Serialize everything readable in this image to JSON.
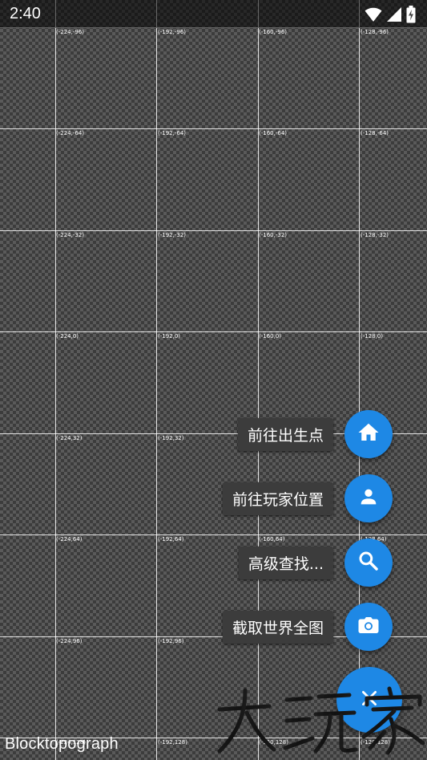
{
  "status_bar": {
    "time": "2:40",
    "icons": [
      "wifi-icon",
      "cell-signal-icon",
      "battery-charging-icon"
    ]
  },
  "map": {
    "coords": [
      "(-224,-96)",
      "(-192,-96)",
      "(-160,-96)",
      "(-128,-96)",
      "(-224,-64)",
      "(-192,-64)",
      "(-160,-64)",
      "(-128,-64)",
      "(-224,-32)",
      "(-192,-32)",
      "(-160,-32)",
      "(-128,-32)",
      "(-224,0)",
      "(-192,0)",
      "(-160,0)",
      "(-128,0)",
      "(-224,32)",
      "(-192,32)",
      "(-224,64)",
      "(-192,64)",
      "(-160,64)",
      "(-128,64)",
      "(-224,96)",
      "(-192,96)",
      "(-224,128)",
      "(-192,128)",
      "(-160,128)",
      "(-128,128)"
    ]
  },
  "fab_menu": {
    "items": [
      {
        "label": "前往出生点",
        "icon": "home-icon"
      },
      {
        "label": "前往玩家位置",
        "icon": "person-icon"
      },
      {
        "label": "高级查找...",
        "icon": "search-icon"
      },
      {
        "label": "截取世界全图",
        "icon": "camera-icon"
      }
    ],
    "main_icon": "close-icon"
  },
  "app_name": "Blocktopograph",
  "watermark_text": "大玩家",
  "colors": {
    "fab": "#1e88e5",
    "label_bg": "#3c3c3c"
  }
}
